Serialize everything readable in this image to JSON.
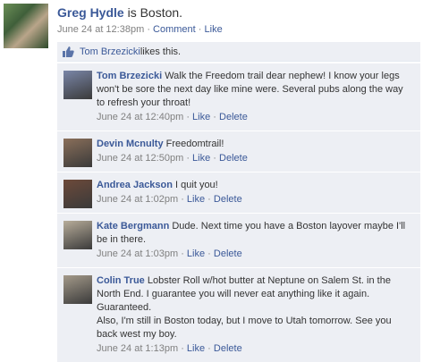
{
  "post": {
    "author": "Greg Hydle",
    "text": " is Boston.",
    "date": "June 24 at 12:38pm",
    "comment_label": "Comment",
    "like_label": "Like"
  },
  "likes": {
    "name": "Tom Brzezicki",
    "suffix": " likes this."
  },
  "comments": [
    {
      "author": "Tom Brzezicki",
      "text": " Walk the Freedom trail dear nephew! I know your legs won't be sore the next day like mine were. Several pubs along the way to refresh your throat!",
      "date": "June 24 at 12:40pm",
      "like": "Like",
      "delete": "Delete",
      "avatar_color": "#7a86a8"
    },
    {
      "author": "Devin Mcnulty",
      "text": " Freedomtrail!",
      "date": "June 24 at 12:50pm",
      "like": "Like",
      "delete": "Delete",
      "avatar_color": "#8a6f5a"
    },
    {
      "author": "Andrea Jackson",
      "text": " I quit you!",
      "date": "June 24 at 1:02pm",
      "like": "Like",
      "delete": "Delete",
      "avatar_color": "#6d4a3a"
    },
    {
      "author": "Kate Bergmann",
      "text": " Dude. Next time you have a Boston layover maybe I'll be in there.",
      "date": "June 24 at 1:03pm",
      "like": "Like",
      "delete": "Delete",
      "avatar_color": "#b8ad9a"
    },
    {
      "author": "Colin True",
      "text": " Lobster Roll w/hot butter at Neptune on Salem St. in the North End. I guarantee you will never eat anything like it again. Guaranteed.\nAlso, I'm still in Boston today, but I move to Utah tomorrow. See you back west my boy.",
      "date": "June 24 at 1:13pm",
      "like": "Like",
      "delete": "Delete",
      "avatar_color": "#a49a8a"
    }
  ]
}
